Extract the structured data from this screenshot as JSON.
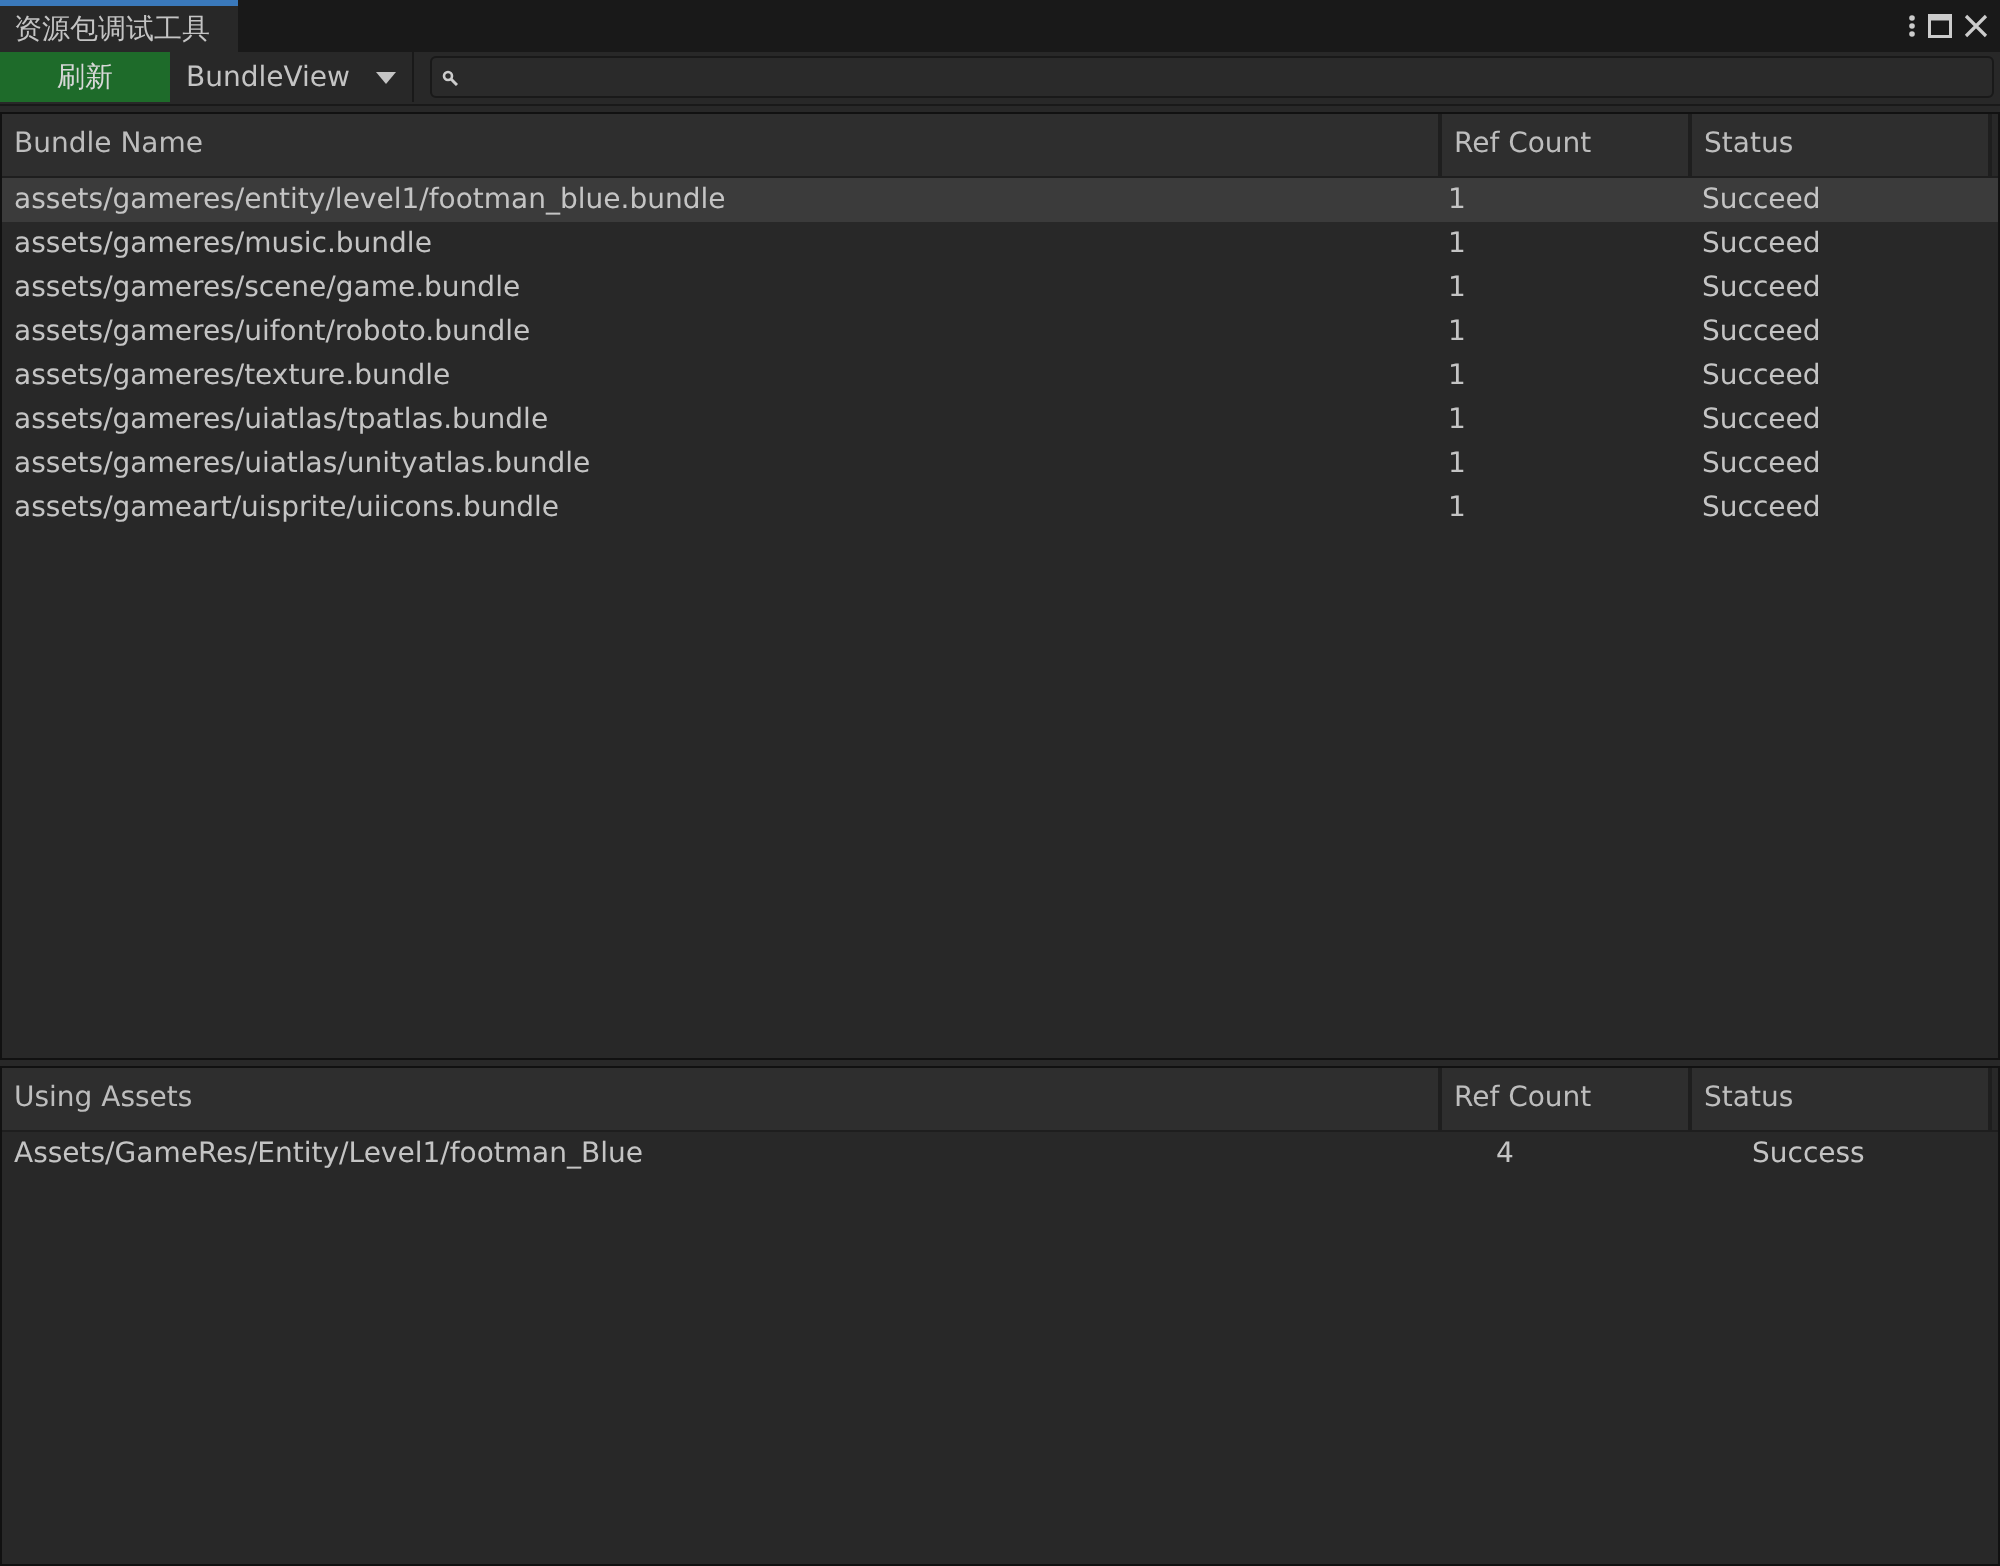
{
  "window": {
    "title": "资源包调试工具"
  },
  "toolbar": {
    "refresh_button": "刷新",
    "view_dropdown": "BundleView"
  },
  "bundle_table": {
    "columns": [
      "Bundle Name",
      "Ref Count",
      "Status"
    ],
    "rows": [
      {
        "cells": [
          "assets/gameres/entity/level1/footman_blue.bundle",
          "1",
          "Succeed"
        ],
        "selected": true
      },
      {
        "cells": [
          "assets/gameres/music.bundle",
          "1",
          "Succeed"
        ],
        "selected": false
      },
      {
        "cells": [
          "assets/gameres/scene/game.bundle",
          "1",
          "Succeed"
        ],
        "selected": false
      },
      {
        "cells": [
          "assets/gameres/uifont/roboto.bundle",
          "1",
          "Succeed"
        ],
        "selected": false
      },
      {
        "cells": [
          "assets/gameres/texture.bundle",
          "1",
          "Succeed"
        ],
        "selected": false
      },
      {
        "cells": [
          "assets/gameres/uiatlas/tpatlas.bundle",
          "1",
          "Succeed"
        ],
        "selected": false
      },
      {
        "cells": [
          "assets/gameres/uiatlas/unityatlas.bundle",
          "1",
          "Succeed"
        ],
        "selected": false
      },
      {
        "cells": [
          "assets/gameart/uisprite/uiicons.bundle",
          "1",
          "Succeed"
        ],
        "selected": false
      }
    ]
  },
  "assets_table": {
    "columns": [
      "Using Assets",
      "Ref Count",
      "Status"
    ],
    "rows": [
      {
        "cells": [
          "Assets/GameRes/Entity/Level1/footman_Blue",
          "4",
          "Success"
        ],
        "selected": false
      }
    ]
  }
}
